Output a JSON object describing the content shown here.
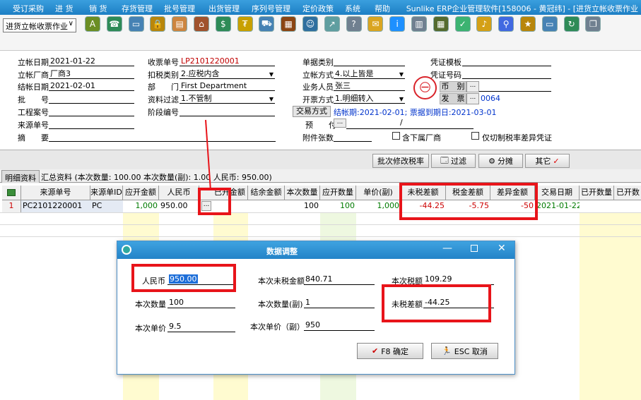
{
  "menubar": {
    "items": [
      "受订采购",
      "进 货",
      "销 货",
      "存货管理",
      "批号管理",
      "出货管理",
      "序列号管理",
      "定价政策",
      "系统",
      "帮助"
    ],
    "title": "Sunlike ERP企业管理软件[158006 - 黄冠纬] - [进货立帐收票作业"
  },
  "toolbar": {
    "module": "进货立帐收票作业",
    "icons": [
      "abc-icon",
      "phone-icon",
      "computer-icon",
      "lock-icon",
      "briefcase-icon",
      "home-icon",
      "dollar-icon",
      "money-bag-icon",
      "cart-icon",
      "clipboard-icon",
      "users-icon",
      "arrow-icon",
      "help-icon",
      "mail-icon",
      "info-icon",
      "calculator-icon",
      "grid-icon",
      "check-icon",
      "bell-icon",
      "search-icon",
      "medal-icon",
      "monitor-icon",
      "refresh-icon",
      "window-icon"
    ]
  },
  "form": {
    "col1": [
      {
        "label": "立帐日期",
        "value": "2021-01-22"
      },
      {
        "label": "立帐厂商",
        "value": "厂商3"
      },
      {
        "label": "结帐日期",
        "value": "2021-02-01"
      },
      {
        "label": "批　　号",
        "value": ""
      },
      {
        "label": "工程案号",
        "value": ""
      },
      {
        "label": "来源单号",
        "value": ""
      },
      {
        "label": "摘　　要",
        "value": ""
      }
    ],
    "col2": [
      {
        "label": "收票单号",
        "value": "LP2101220001"
      },
      {
        "label": "扣税类别",
        "value": "2.应税内含"
      },
      {
        "label": "部　　门",
        "value": "First Department"
      },
      {
        "label": "资料过滤",
        "value": "1.不管制"
      },
      {
        "label": "阶段编号",
        "value": ""
      }
    ],
    "col3": [
      {
        "label": "单据类别",
        "value": ""
      },
      {
        "label": "立帐方式",
        "value": "4.以上皆是"
      },
      {
        "label": "业务人员",
        "value": "张三"
      },
      {
        "label": "开票方式",
        "value": "1.明细转入"
      }
    ],
    "trade_btn": "交易方式",
    "trade_info": "结帐期:2021-02-01; 票据到期日:2021-03-01",
    "prepay_label": "预　　付",
    "prepay_btn": "...",
    "attach_label": "附件张数",
    "check_sub": "含下属厂商",
    "check_tax": "仅切制税率差异凭证",
    "col4": [
      {
        "label": "凭证模板",
        "value": ""
      },
      {
        "label": "凭证号码",
        "value": ""
      }
    ],
    "currency_label": "币　别",
    "currency_btn": "...",
    "invoice_label": "发　票",
    "invoice_btn": "...",
    "invoice_value": "0064"
  },
  "actions": {
    "batch_tax": "批次修改税率",
    "filter": "过滤",
    "split": "分摊",
    "other": "其它"
  },
  "tabs": {
    "detail": "明细资料",
    "summary": "汇总资料 (本次数量: 100.00 本次数量(副): 1.00 人民币: 950.00)"
  },
  "grid": {
    "headers": [
      "来源单号",
      "来源单ID",
      "应开金额",
      "人民币",
      "已开金额",
      "结余金额",
      "本次数量",
      "应开数量",
      "单价(副)",
      "未税差额",
      "税金差额",
      "差异金额",
      "交易日期",
      "已开数量",
      "已开数"
    ],
    "row": {
      "num": "1",
      "src_no": "PC2101220001",
      "src_id": "PC",
      "should_amt": "1,000",
      "rmb": "950.00",
      "ellipsis": "...",
      "qty": "100",
      "should_qty": "100",
      "unit_price": "1,000",
      "untaxed_diff": "-44.25",
      "tax_diff": "-5.75",
      "diff_amt": "-50",
      "trade_date": "2021-01-22"
    }
  },
  "dialog": {
    "title": "数据调整",
    "rmb_label": "人民币",
    "rmb_value": "950.00",
    "untaxed_label": "本次未税金额",
    "untaxed_value": "840.71",
    "tax_label": "本次税额",
    "tax_value": "109.29",
    "qty_label": "本次数量",
    "qty_value": "100",
    "qty2_label": "本次数量(副)",
    "qty2_value": "1",
    "diff_label": "未税差额",
    "diff_value": "-44.25",
    "price_label": "本次单价",
    "price_value": "9.5",
    "price2_label": "本次单价（副）",
    "price2_value": "950",
    "ok": "F8 确定",
    "cancel": "ESC 取消"
  },
  "colors": {
    "title_blue": "#2383c8",
    "highlight_red": "#e8141a",
    "yellow_col": "#fffbd0",
    "green_col": "#eef8e0"
  }
}
